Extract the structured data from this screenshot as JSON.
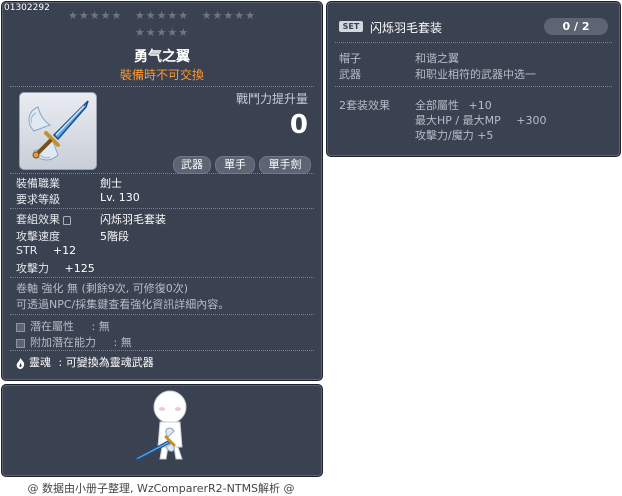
{
  "item_id": "01302292",
  "stars_groups": [
    "★★★★★",
    "★★★★★",
    "★★★★★",
    "★★★★★"
  ],
  "title": "勇气之翼",
  "trade_note": "裝備時不可交換",
  "attack_label": "戰鬥力提升量",
  "attack_value": "0",
  "tags": [
    "武器",
    "單手",
    "單手劍"
  ],
  "stats": {
    "job_label": "裝備職業",
    "job_value": "劍士",
    "req_label": "要求等級",
    "req_value": "Lv. 130",
    "set_label": "套組效果",
    "set_value": "闪烁羽毛套装",
    "speed_label": "攻擊速度",
    "speed_value": "5階段",
    "str_label": "STR",
    "str_value": "+12",
    "atk_label": "攻擊力",
    "atk_value": "+125"
  },
  "enhance_line1": "卷軸 強化 無 (剩餘9次, 可修復0次)",
  "enhance_line2": "可透過NPC/採集鍵查看強化資訊詳細內容。",
  "potential": {
    "label": "潛在屬性",
    "value": ": 無"
  },
  "add_potential": {
    "label": "附加潛在能力",
    "value": ": 無"
  },
  "soul": {
    "label": "靈魂",
    "value": ": 可變換為靈魂武器"
  },
  "set_panel": {
    "badge": "SET",
    "name": "闪烁羽毛套装",
    "count": "0 / 2",
    "items": [
      {
        "slot": "帽子",
        "name": "和谐之翼"
      },
      {
        "slot": "武器",
        "name": "和职业相符的武器中选一"
      }
    ],
    "bonus_label": "2套装效果",
    "bonuses": [
      {
        "stat": "全部屬性",
        "value": "+10"
      },
      {
        "stat": "最大HP / 最大MP",
        "value": "+300"
      },
      {
        "stat": "攻擊力/魔力",
        "value": "+5"
      }
    ]
  },
  "footer": "@ 数据由小册子整理, WzComparerR2-NTMS解析 @"
}
